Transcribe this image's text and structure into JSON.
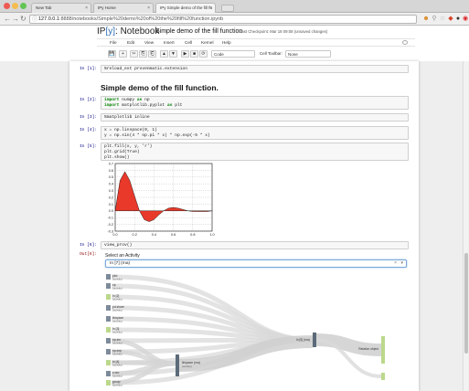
{
  "browser": {
    "tabs": [
      {
        "label": "New Tab"
      },
      {
        "label": "IPy Home"
      },
      {
        "label": "IPy Simple demo of the fill fu"
      }
    ],
    "url_host": "127.0.0.1",
    "url_rest": ":8888/notebooks/Simple%20demo%20of%20the%20fill%20function.ipynb"
  },
  "notebook": {
    "logo_prefix": "IP",
    "logo_bracket_open": "[",
    "logo_y": "y",
    "logo_bracket_close": "]",
    "logo_suffix": ": Notebook",
    "name": "Simple demo of the fill function",
    "checkpoint": "Last Checkpoint: Mar 18 09:08 (unsaved changes)"
  },
  "menu": [
    "File",
    "Edit",
    "View",
    "Insert",
    "Cell",
    "Kernel",
    "Help"
  ],
  "toolbar": {
    "buttons": [
      "💾",
      "+",
      "✂",
      "⎘",
      "⎗",
      "▲",
      "▼",
      "▶",
      "■",
      "⟳"
    ],
    "cell_type": "Code",
    "celltoolbar_label": "Cell Toolbar:",
    "celltoolbar_value": "None"
  },
  "cells": [
    {
      "prompt": "In [1]:",
      "code": "%reload_ext provenmatic.extension"
    },
    {
      "heading": "Simple demo of the fill function."
    },
    {
      "prompt": "In [2]:",
      "line1_kw": "import",
      "line1_rest": " numpy ",
      "line1_kw2": "as",
      "line1_end": " np",
      "line2_kw": "import",
      "line2_rest": " matplotlib.pyplot ",
      "line2_kw2": "as",
      "line2_end": " plt"
    },
    {
      "prompt": "In [3]:",
      "code": "%matplotlib inline"
    },
    {
      "prompt": "In [4]:",
      "line1": "x = np.linspace(0, 1)",
      "line2": "y = np.sin(4 * np.pi * x) * np.exp(-5 * x)"
    },
    {
      "prompt": "In [5]:",
      "line1": "plt.fill(x, y, 'r')",
      "line2": "plt.grid(True)",
      "line3": "plt.show()"
    },
    {
      "prompt": "In [6]:",
      "code": "view_prov()"
    },
    {
      "prompt": "Out[6]:"
    }
  ],
  "chart_data": {
    "type": "area",
    "title": "",
    "xlabel": "",
    "ylabel": "",
    "x": [
      0.0,
      0.05,
      0.1,
      0.15,
      0.2,
      0.25,
      0.3,
      0.35,
      0.4,
      0.45,
      0.5,
      0.55,
      0.6,
      0.65,
      0.7,
      0.75,
      0.8,
      0.85,
      0.9,
      0.95,
      1.0
    ],
    "y": [
      0.0,
      0.45,
      0.58,
      0.45,
      0.22,
      0.0,
      -0.13,
      -0.16,
      -0.13,
      -0.06,
      0.0,
      0.04,
      0.05,
      0.04,
      0.02,
      0.0,
      -0.01,
      -0.01,
      -0.01,
      -0.01,
      0.0
    ],
    "xlim": [
      0.0,
      1.0
    ],
    "ylim": [
      -0.3,
      0.7
    ],
    "xticks": [
      "0.0",
      "0.2",
      "0.4",
      "0.6",
      "0.8",
      "1.0"
    ],
    "yticks": [
      "0.7",
      "0.6",
      "0.5",
      "0.4",
      "0.3",
      "0.2",
      "0.1",
      "0.0",
      "-0.1",
      "-0.2",
      "-0.3"
    ],
    "grid": true,
    "fill_color": "#e8392b"
  },
  "widget": {
    "label": "Select an Activity",
    "selected": "In [7] (rna)",
    "clear": "×",
    "arrow": "▾",
    "nodes": [
      {
        "name": "pkd",
        "sub": "(activity)"
      },
      {
        "name": "np",
        "sub": "(activity)"
      },
      {
        "name": "In [2]",
        "sub": "(activity)"
      },
      {
        "name": "pd.share",
        "sub": "(activity)"
      },
      {
        "name": "linspace",
        "sub": "(activity)"
      },
      {
        "name": "In [3]",
        "sub": "(activity)"
      },
      {
        "name": "np.sin",
        "sub": "(activity)"
      },
      {
        "name": "np.exp",
        "sub": "(activity)"
      },
      {
        "name": "In [4]",
        "sub": "(activity)"
      },
      {
        "name": "x.reo",
        "sub": "(activity)"
      },
      {
        "name": "group",
        "sub": "(activity)"
      }
    ],
    "mid_node": {
      "name": "linspace (rna)",
      "sub": "(activity)"
    },
    "right_node": {
      "name": "In [5] (rna)"
    },
    "far_node": {
      "name": "Relation object"
    }
  }
}
